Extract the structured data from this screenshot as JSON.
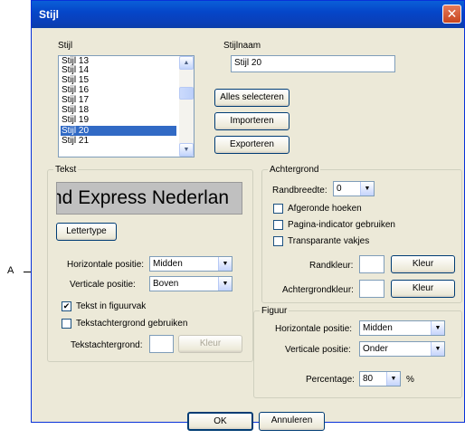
{
  "window": {
    "title": "Stijl",
    "close_glyph": "✕"
  },
  "annotation": {
    "callout": "A"
  },
  "stijl": {
    "label": "Stijl",
    "items": [
      "Stijl 13",
      "Stijl 14",
      "Stijl 15",
      "Stijl 16",
      "Stijl 17",
      "Stijl 18",
      "Stijl 19",
      "Stijl 20",
      "Stijl 21"
    ],
    "selected": "Stijl 20"
  },
  "stijlnaam": {
    "label": "Stijlnaam",
    "value": "Stijl 20"
  },
  "buttons": {
    "select_all": "Alles selecteren",
    "import": "Importeren",
    "export": "Exporteren",
    "ok": "OK",
    "cancel": "Annuleren"
  },
  "tekst": {
    "group_label": "Tekst",
    "preview": "nd Express Nederlan",
    "font_button": "Lettertype",
    "horizontal_label": "Horizontale positie:",
    "horizontal_value": "Midden",
    "vertical_label": "Verticale positie:",
    "vertical_value": "Boven",
    "text_in_frame": "Tekst in figuurvak",
    "text_in_frame_checked": true,
    "use_background": "Tekstachtergrond gebruiken",
    "use_background_checked": false,
    "background_label": "Tekstachtergrond:",
    "background_color_button": "Kleur"
  },
  "achtergrond": {
    "group_label": "Achtergrond",
    "border_width_label": "Randbreedte:",
    "border_width_value": "0",
    "rounded_corners": "Afgeronde hoeken",
    "page_indicator": "Pagina-indicator gebruiken",
    "transparent_boxes": "Transparante vakjes",
    "border_color_label": "Randkleur:",
    "background_color_label": "Achtergrondkleur:",
    "color_button": "Kleur"
  },
  "figuur": {
    "group_label": "Figuur",
    "horizontal_label": "Horizontale positie:",
    "horizontal_value": "Midden",
    "vertical_label": "Verticale positie:",
    "vertical_value": "Onder",
    "percentage_label": "Percentage:",
    "percentage_value": "80",
    "percentage_unit": "%"
  },
  "icons": {
    "dropdown": "▼",
    "scroll_up": "▲",
    "scroll_down": "▼",
    "check": "✔"
  },
  "colors": {
    "titlebar": "#0546c9",
    "selection": "#316ac5",
    "dialog_bg": "#ece9d8",
    "close": "#c8451e"
  }
}
